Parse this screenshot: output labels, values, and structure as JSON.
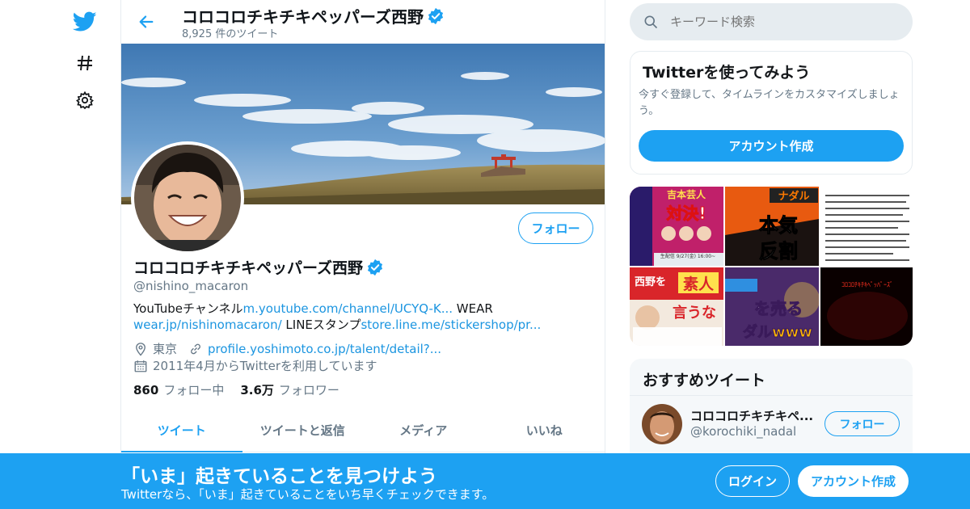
{
  "colors": {
    "brand": "#1da1f2",
    "link": "#1b95e0",
    "muted": "#657786",
    "text": "#14171a",
    "border": "#e6ecf0"
  },
  "header": {
    "name": "コロコロチキチキペッパーズ西野",
    "tweet_count": "8,925 件のツイート"
  },
  "profile": {
    "follow_label": "フォロー",
    "name": "コロコロチキチキペッパーズ西野",
    "handle": "@nishino_macaron",
    "bio": {
      "text1": "YouTubeチャンネル",
      "link1": "m.youtube.com/channel/UCYQ-K...",
      "text2": " WEAR",
      "link2": "wear.jp/nishinomacaron/",
      "text3": " LINEスタンプ",
      "link3": "store.line.me/stickershop/pr..."
    },
    "location": "東京",
    "website": "profile.yoshimoto.co.jp/talent/detail?...",
    "joined": "2011年4月からTwitterを利用しています",
    "following_count": "860",
    "following_label": "フォロー中",
    "followers_count": "3.6万",
    "followers_label": "フォロワー"
  },
  "tabs": [
    {
      "label": "ツイート",
      "active": true
    },
    {
      "label": "ツイートと返信"
    },
    {
      "label": "メディア"
    },
    {
      "label": "いいね"
    }
  ],
  "search": {
    "placeholder": "キーワード検索"
  },
  "signup_card": {
    "title": "Twitterを使ってみよう",
    "desc": "今すぐ登録して、タイムラインをカスタマイズしましょう。",
    "button": "アカウント作成"
  },
  "media_thumbs": {
    "t1_line1": "吉本芸人",
    "t1_line2": "対決!",
    "t1_date": "生配信 9/27(金) 16:00~",
    "t2_badge": "ナダル",
    "t2_line1": "本気",
    "t2_line2": "反割",
    "t4_line1": "西野を",
    "t4_hl": "素人",
    "t4_line2": "言うな",
    "t5_line1": "を売る",
    "t5_line2": "ダルwww",
    "t6_label": "ｺﾛｺﾛﾁｷﾁｷﾍﾟｯﾊﾟｰｽﾞ"
  },
  "suggest": {
    "title": "おすすめツイート",
    "name": "コロコロチキチキペ...",
    "handle": "@korochiki_nadal",
    "follow_label": "フォロー"
  },
  "bottom_bar": {
    "title": "「いま」起きていることを見つけよう",
    "subtitle": "Twitterなら、「いま」起きていることをいち早くチェックできます。",
    "login": "ログイン",
    "signup": "アカウント作成"
  }
}
